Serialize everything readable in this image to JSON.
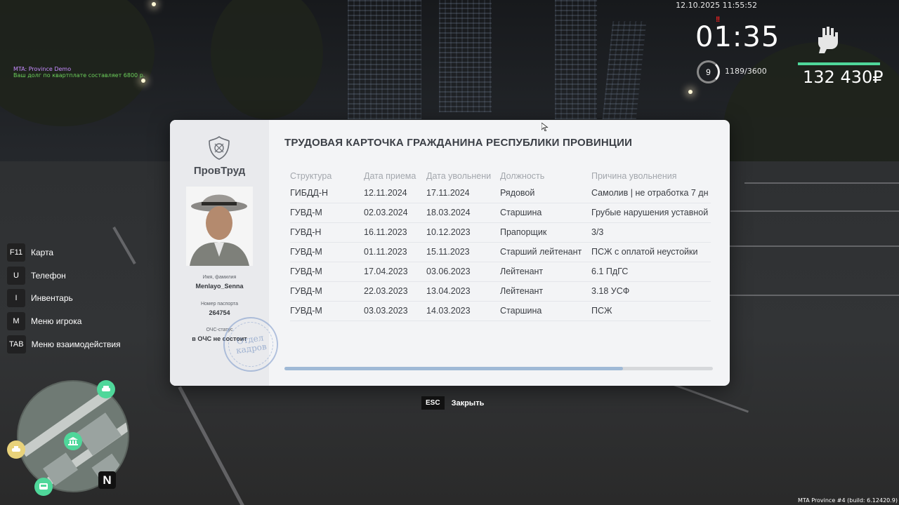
{
  "hud": {
    "chat": [
      "MTA: Province Demo",
      "Ваш долг по квартплате составляет 6800 р."
    ],
    "datetime": "12.10.2025 11:55:52",
    "alert_mark": "!!",
    "clock": "01:35",
    "level": "9",
    "xp": "1189/3600",
    "money": "132 430₽",
    "build": "MTA Province #4 (build: 6.12420.9)"
  },
  "keys": [
    {
      "key": "F11",
      "label": "Карта"
    },
    {
      "key": "U",
      "label": "Телефон"
    },
    {
      "key": "I",
      "label": "Инвентарь"
    },
    {
      "key": "M",
      "label": "Меню игрока"
    },
    {
      "key": "TAB",
      "label": "Меню взаимодействия"
    }
  ],
  "minimap": {
    "north": "N"
  },
  "card": {
    "org": "ПровТруд",
    "title": "ТРУДОВАЯ КАРТОЧКА ГРАЖДАНИНА РЕСПУБЛИКИ ПРОВИНЦИИ",
    "name_caption": "Имя, фамилия",
    "name": "Menlayo_Senna",
    "passport_caption": "Номер паспорта",
    "passport": "264754",
    "ochs_caption": "ОЧС-статус",
    "ochs": "в ОЧС не состоит",
    "stamp_text": "Отдел кадров",
    "columns": [
      "Структура",
      "Дата приема",
      "Дата увольнени",
      "Должность",
      "Причина увольнения"
    ],
    "rows": [
      [
        "ГИБДД-Н",
        "12.11.2024",
        "17.11.2024",
        "Рядовой",
        "Самолив | не отработка 7 дн"
      ],
      [
        "ГУВД-М",
        "02.03.2024",
        "18.03.2024",
        "Старшина",
        "Грубые нарушения уставной"
      ],
      [
        "ГУВД-Н",
        "16.11.2023",
        "10.12.2023",
        "Прапорщик",
        "3/3"
      ],
      [
        "ГУВД-М",
        "01.11.2023",
        "15.11.2023",
        "Старший лейтенант",
        "ПСЖ с оплатой неустойки"
      ],
      [
        "ГУВД-М",
        "17.04.2023",
        "03.06.2023",
        "Лейтенант",
        "6.1 ПдГС"
      ],
      [
        "ГУВД-М",
        "22.03.2023",
        "13.04.2023",
        "Лейтенант",
        "3.18 УСФ"
      ],
      [
        "ГУВД-М",
        "03.03.2023",
        "14.03.2023",
        "Старшина",
        "ПСЖ"
      ]
    ],
    "scroll_fraction": 0.79,
    "esc_key": "ESC",
    "close_label": "Закрыть"
  },
  "colors": {
    "money_bar": "#4fd79a",
    "chat_system": "#c78cff",
    "chat_info": "#6dd15c"
  }
}
